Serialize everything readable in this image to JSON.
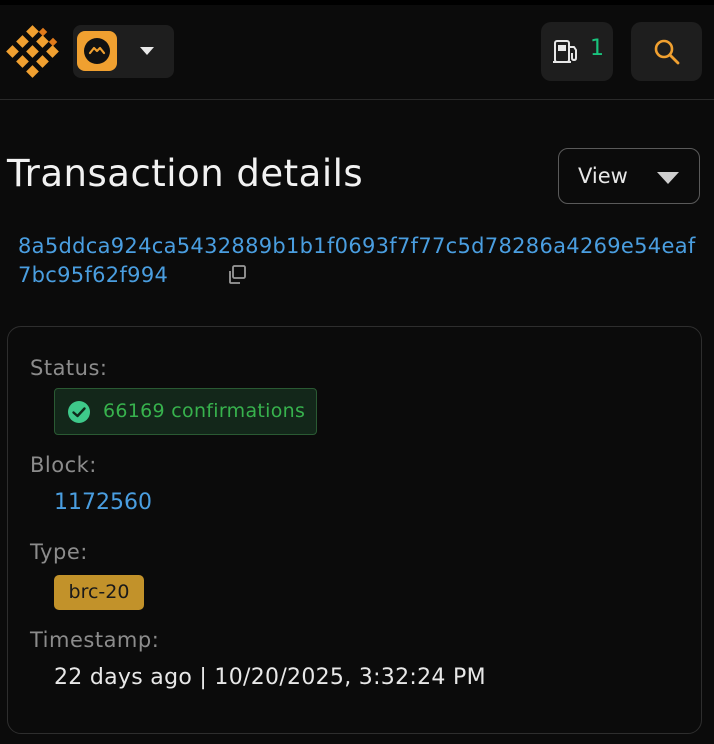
{
  "header": {
    "logo_name": "logo-icon",
    "network_icon": "network-token-icon",
    "gas_icon": "fuel-pump-icon",
    "gas_count": "1",
    "search_icon": "search-icon"
  },
  "page": {
    "title": "Transaction details",
    "view_label": "View"
  },
  "transaction": {
    "hash": "8a5ddca924ca5432889b1b1f0693f7f77c5d78286a4269e54eaf7bc95f62f994",
    "status_label": "Status:",
    "status_text": "66169 confirmations",
    "block_label": "Block:",
    "block_value": "1172560",
    "type_label": "Type:",
    "type_value": "brc-20",
    "timestamp_label": "Timestamp:",
    "timestamp_value": "22 days ago | 10/20/2025, 3:32:24 PM"
  },
  "colors": {
    "accent": "#f0a030",
    "link": "#4a9ee0",
    "success": "#37b24d",
    "badge": "#c2922a"
  }
}
